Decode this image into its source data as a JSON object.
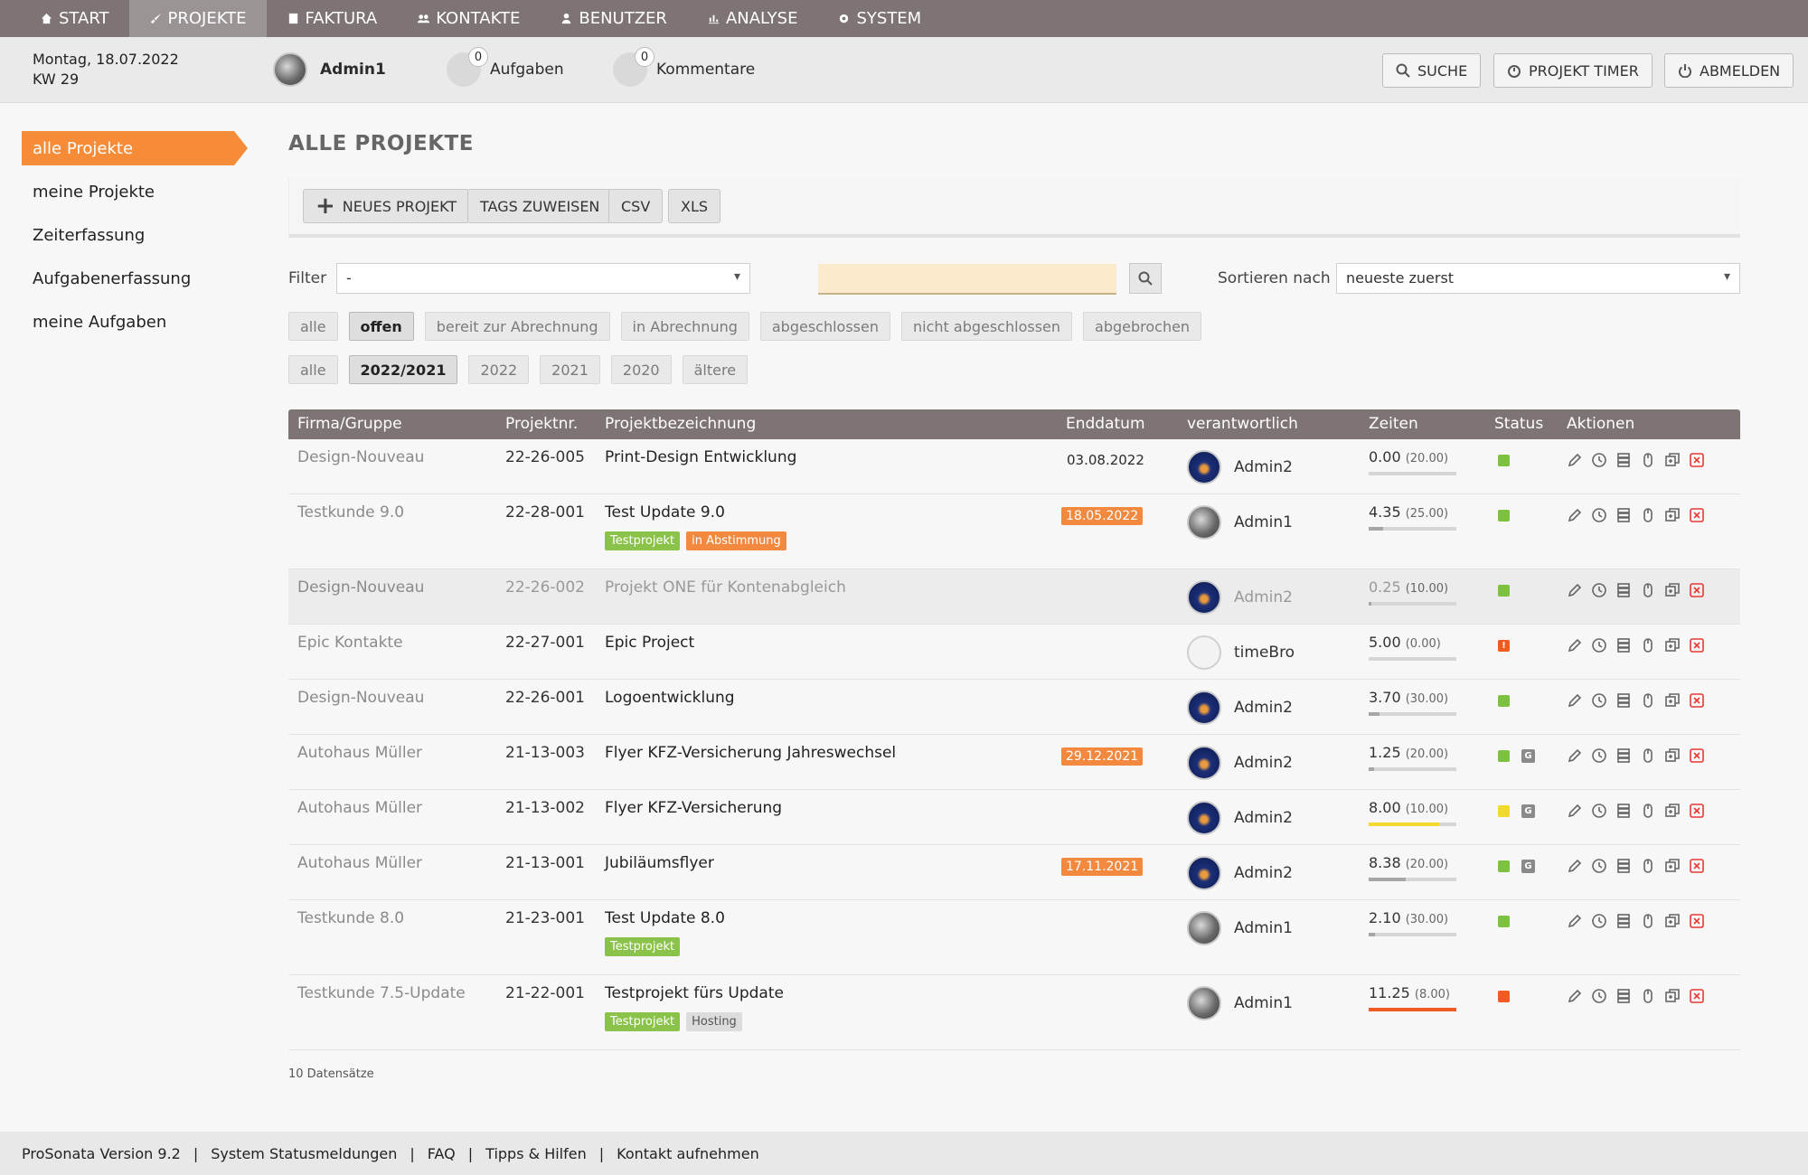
{
  "nav": [
    {
      "label": "START",
      "icon": "home-icon"
    },
    {
      "label": "PROJEKTE",
      "icon": "rocket-icon",
      "active": true
    },
    {
      "label": "FAKTURA",
      "icon": "invoice-icon"
    },
    {
      "label": "KONTAKTE",
      "icon": "contacts-icon"
    },
    {
      "label": "BENUTZER",
      "icon": "user-icon"
    },
    {
      "label": "ANALYSE",
      "icon": "chart-icon"
    },
    {
      "label": "SYSTEM",
      "icon": "gear-icon"
    }
  ],
  "header": {
    "date_line1": "Montag, 18.07.2022",
    "date_line2": "KW 29",
    "user": "Admin1",
    "tasks_label": "Aufgaben",
    "tasks_count": "0",
    "comments_label": "Kommentare",
    "comments_count": "0",
    "search_btn": "SUCHE",
    "timer_btn": "PROJEKT TIMER",
    "logout_btn": "ABMELDEN"
  },
  "sidebar": [
    {
      "label": "alle Projekte",
      "active": true
    },
    {
      "label": "meine Projekte"
    },
    {
      "label": "Zeiterfassung"
    },
    {
      "label": "Aufgabenerfassung"
    },
    {
      "label": "meine Aufgaben"
    }
  ],
  "page_title": "ALLE PROJEKTE",
  "toolbar": {
    "new_project": "NEUES PROJEKT",
    "assign_tags": "TAGS ZUWEISEN",
    "csv": "CSV",
    "xls": "XLS"
  },
  "filter": {
    "label": "Filter",
    "value": "-",
    "search_value": "",
    "sort_label": "Sortieren nach",
    "sort_value": "neueste zuerst"
  },
  "status_pills": [
    "alle",
    "offen",
    "bereit zur Abrechnung",
    "in Abrechnung",
    "abgeschlossen",
    "nicht abgeschlossen",
    "abgebrochen"
  ],
  "status_selected": 1,
  "year_pills": [
    "alle",
    "2022/2021",
    "2022",
    "2021",
    "2020",
    "ältere"
  ],
  "year_selected": 1,
  "table": {
    "headers": [
      "Firma/Gruppe",
      "Projektnr.",
      "Projektbezeichnung",
      "Enddatum",
      "verantwortlich",
      "Zeiten",
      "Status",
      "Aktionen"
    ],
    "rows": [
      {
        "firm": "Design-Nouveau",
        "nr": "22-26-005",
        "name": "Print-Design Entwicklung",
        "end": "03.08.2022",
        "end_overdue": false,
        "tags": [],
        "resp": "Admin2",
        "avatar": "blue",
        "time": "0.00",
        "budget": "(20.00)",
        "progress": 0,
        "bar_color": "#d6d6d6",
        "status_color": "#7cc142",
        "status_icon": "",
        "extra": false,
        "dim": false
      },
      {
        "firm": "Testkunde 9.0",
        "nr": "22-28-001",
        "name": "Test Update 9.0",
        "end": "18.05.2022",
        "end_overdue": true,
        "tags": [
          {
            "label": "Testprojekt",
            "c": "green"
          },
          {
            "label": "in Abstimmung",
            "c": "orange"
          }
        ],
        "resp": "Admin1",
        "avatar": "gray",
        "time": "4.35",
        "budget": "(25.00)",
        "progress": 0.17,
        "bar_color": "#a6a6a6",
        "status_color": "#7cc142",
        "status_icon": "",
        "extra": false,
        "dim": false
      },
      {
        "firm": "Design-Nouveau",
        "nr": "22-26-002",
        "name": "Projekt ONE für Kontenabgleich",
        "end": "",
        "end_overdue": false,
        "tags": [],
        "resp": "Admin2",
        "avatar": "blue",
        "time": "0.25",
        "budget": "(10.00)",
        "progress": 0.03,
        "bar_color": "#a6a6a6",
        "status_color": "#7cc142",
        "status_icon": "",
        "extra": false,
        "dim": true
      },
      {
        "firm": "Epic Kontakte",
        "nr": "22-27-001",
        "name": "Epic Project",
        "end": "",
        "end_overdue": false,
        "tags": [],
        "resp": "timeBro",
        "avatar": "white",
        "time": "5.00",
        "budget": "(0.00)",
        "progress": 0,
        "bar_color": "#d6d6d6",
        "status_color": "#f15a24",
        "status_icon": "!",
        "extra": false,
        "dim": false
      },
      {
        "firm": "Design-Nouveau",
        "nr": "22-26-001",
        "name": "Logoentwicklung",
        "end": "",
        "end_overdue": false,
        "tags": [],
        "resp": "Admin2",
        "avatar": "blue",
        "time": "3.70",
        "budget": "(30.00)",
        "progress": 0.12,
        "bar_color": "#a6a6a6",
        "status_color": "#7cc142",
        "status_icon": "",
        "extra": false,
        "dim": false
      },
      {
        "firm": "Autohaus Müller",
        "nr": "21-13-003",
        "name": "Flyer KFZ-Versicherung Jahreswechsel",
        "end": "29.12.2021",
        "end_overdue": true,
        "tags": [],
        "resp": "Admin2",
        "avatar": "blue",
        "time": "1.25",
        "budget": "(20.00)",
        "progress": 0.06,
        "bar_color": "#a6a6a6",
        "status_color": "#7cc142",
        "status_icon": "",
        "extra": true,
        "dim": false
      },
      {
        "firm": "Autohaus Müller",
        "nr": "21-13-002",
        "name": "Flyer KFZ-Versicherung",
        "end": "",
        "end_overdue": false,
        "tags": [],
        "resp": "Admin2",
        "avatar": "blue",
        "time": "8.00",
        "budget": "(10.00)",
        "progress": 0.8,
        "bar_color": "#f2d92e",
        "status_color": "#f2d92e",
        "status_icon": "",
        "extra": true,
        "dim": false
      },
      {
        "firm": "Autohaus Müller",
        "nr": "21-13-001",
        "name": "Jubiläumsflyer",
        "end": "17.11.2021",
        "end_overdue": true,
        "tags": [],
        "resp": "Admin2",
        "avatar": "blue",
        "time": "8.38",
        "budget": "(20.00)",
        "progress": 0.42,
        "bar_color": "#a6a6a6",
        "status_color": "#7cc142",
        "status_icon": "",
        "extra": true,
        "dim": false
      },
      {
        "firm": "Testkunde 8.0",
        "nr": "21-23-001",
        "name": "Test Update 8.0",
        "end": "",
        "end_overdue": false,
        "tags": [
          {
            "label": "Testprojekt",
            "c": "green"
          }
        ],
        "resp": "Admin1",
        "avatar": "gray",
        "time": "2.10",
        "budget": "(30.00)",
        "progress": 0.07,
        "bar_color": "#a6a6a6",
        "status_color": "#7cc142",
        "status_icon": "",
        "extra": false,
        "dim": false
      },
      {
        "firm": "Testkunde 7.5-Update",
        "nr": "21-22-001",
        "name": "Testprojekt fürs Update",
        "end": "",
        "end_overdue": false,
        "tags": [
          {
            "label": "Testprojekt",
            "c": "green"
          },
          {
            "label": "Hosting",
            "c": "gray"
          }
        ],
        "resp": "Admin1",
        "avatar": "gray",
        "time": "11.25",
        "budget": "(8.00)",
        "progress": 1,
        "bar_color": "#f15a24",
        "status_color": "#f15a24",
        "status_icon": "",
        "extra": false,
        "dim": false
      }
    ]
  },
  "record_count": "10 Datensätze",
  "extra_icon_label": "G",
  "footer": [
    "ProSonata Version 9.2",
    "|",
    "System Statusmeldungen",
    "|",
    "FAQ",
    "|",
    "Tipps & Hilfen",
    "|",
    "Kontakt aufnehmen"
  ]
}
